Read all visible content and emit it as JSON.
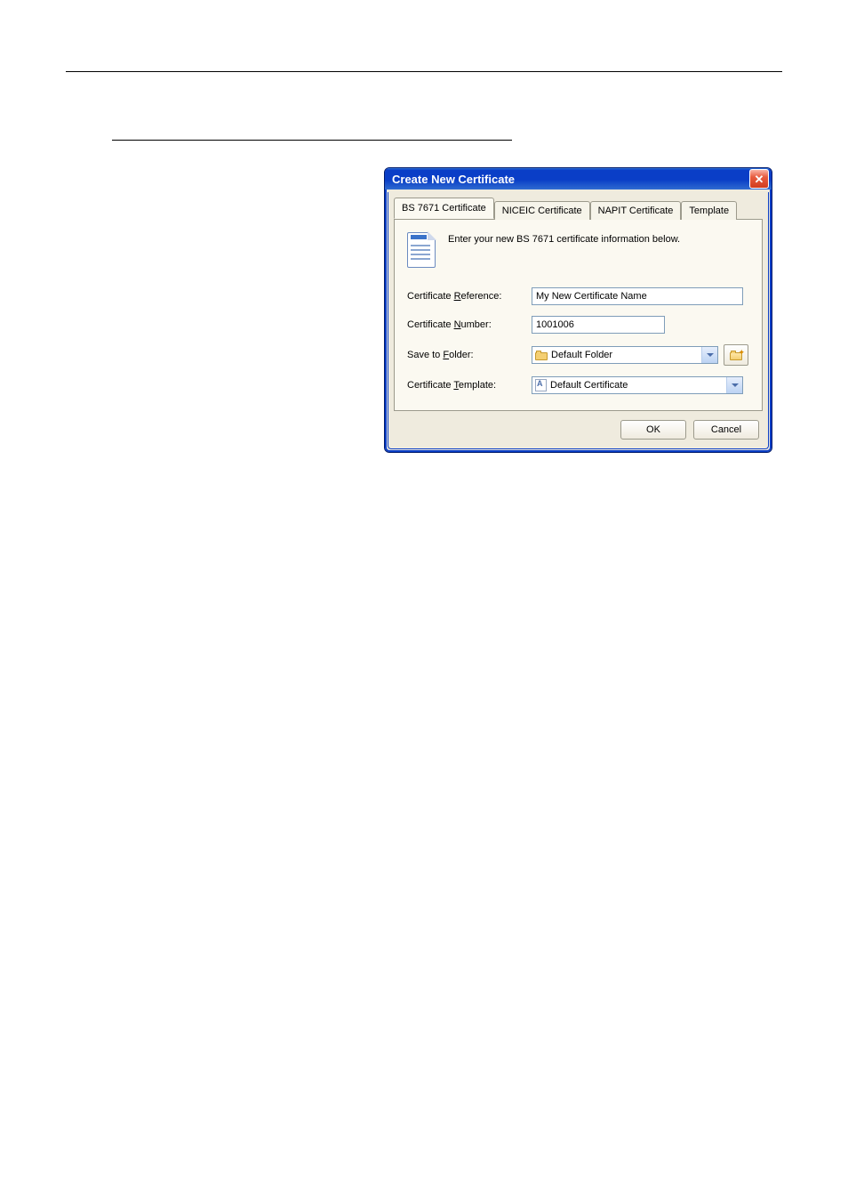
{
  "dialog": {
    "title": "Create New Certificate",
    "tabs": [
      {
        "label": "BS 7671 Certificate"
      },
      {
        "label": "NICEIC Certificate"
      },
      {
        "label": "NAPIT Certificate"
      },
      {
        "label": "Template"
      }
    ],
    "intro": "Enter your new BS 7671 certificate information below.",
    "fields": {
      "referenceLabelPrefix": "Certificate ",
      "referenceAccel": "R",
      "referenceLabelSuffix": "eference:",
      "referenceValue": "My New Certificate Name",
      "numberLabelPrefix": "Certificate ",
      "numberAccel": "N",
      "numberLabelSuffix": "umber:",
      "numberValue": "1001006",
      "folderLabelPrefix": "Save to ",
      "folderAccel": "F",
      "folderLabelSuffix": "older:",
      "folderValue": "Default Folder",
      "templateLabelPrefix": "Certificate ",
      "templateAccel": "T",
      "templateLabelSuffix": "emplate:",
      "templateValue": "Default Certificate"
    },
    "buttons": {
      "ok": "OK",
      "cancel": "Cancel"
    }
  }
}
